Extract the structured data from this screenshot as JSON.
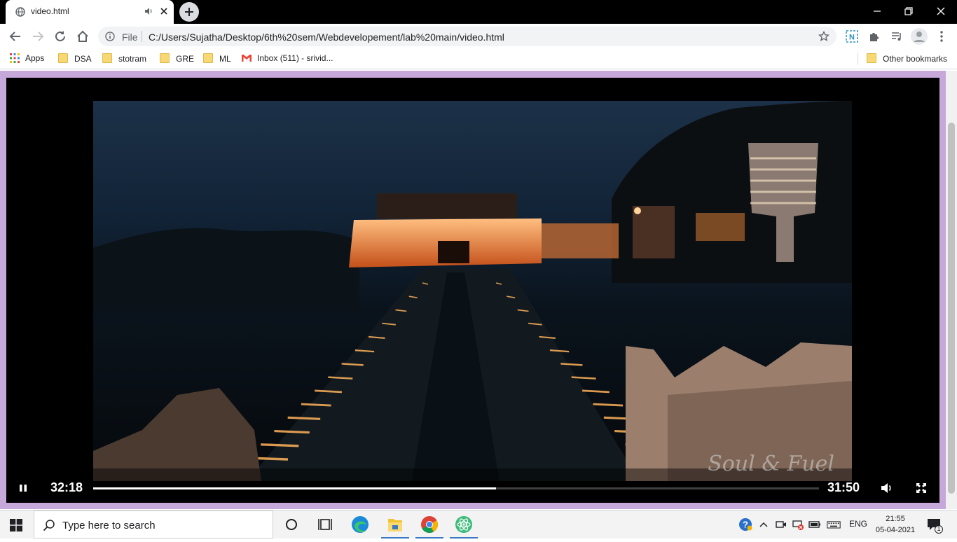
{
  "browser": {
    "tab": {
      "title": "video.html"
    },
    "address": {
      "scheme_label": "File",
      "url": "C:/Users/Sujatha/Desktop/6th%20sem/Webdevelopement/lab%20main/video.html"
    },
    "bookmarks": {
      "apps": "Apps",
      "items": [
        "DSA",
        "stotram",
        "GRE",
        "ML"
      ],
      "gmail": "Inbox (511) - srivid...",
      "other": "Other bookmarks"
    }
  },
  "video": {
    "current_time": "32:18",
    "duration": "31:50",
    "progress": 0.555,
    "watermark": "Soul & Fuel"
  },
  "taskbar": {
    "search_placeholder": "Type here to search",
    "language": "ENG",
    "time": "21:55",
    "date": "05-04-2021",
    "notification_count": "1"
  },
  "colors": {
    "page_background": "#c7a8db",
    "player_background": "#000000",
    "taskbar_accent": "#3b78c4"
  }
}
